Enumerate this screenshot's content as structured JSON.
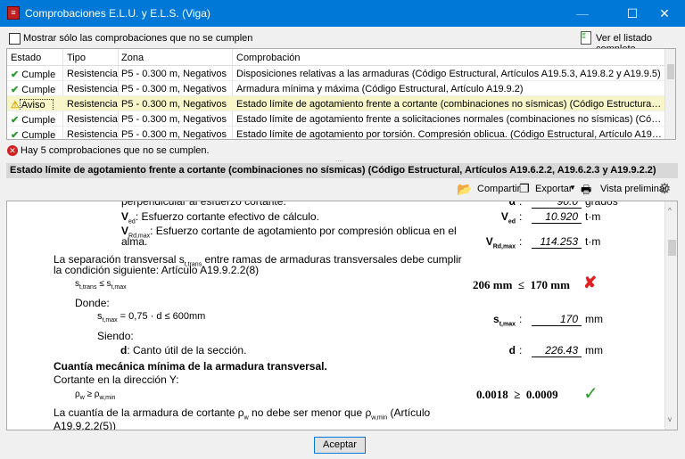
{
  "window": {
    "title": "Comprobaciones E.L.U. y E.L.S. (Viga)",
    "minimize": "—",
    "maximize": "☐",
    "close": "✕"
  },
  "filter": {
    "checkbox_label": "Mostrar sólo las comprobaciones que no se cumplen",
    "checked": false,
    "full_list_label": "Ver el listado completo"
  },
  "table": {
    "headers": [
      "Estado",
      "Tipo",
      "Zona",
      "Comprobación"
    ],
    "rows": [
      {
        "estado": "Cumple",
        "icon": "check",
        "tipo": "Resistencia",
        "zona": "P5 - 0.300 m, Negativos",
        "comprobacion": "Disposiciones relativas a las armaduras (Código Estructural, Artículos A19.5.3, A19.8.2 y A19.9.5)"
      },
      {
        "estado": "Cumple",
        "icon": "check",
        "tipo": "Resistencia",
        "zona": "P5 - 0.300 m, Negativos",
        "comprobacion": "Armadura mínima y máxima (Código Estructural, Artículo A19.9.2)"
      },
      {
        "estado": "Aviso",
        "icon": "warning",
        "tipo": "Resistencia",
        "zona": "P5 - 0.300 m, Negativos",
        "comprobacion": "Estado límite de agotamiento frente a cortante (combinaciones no sísmicas) (Código Estructural, Artículos A19.6.2.2, ..."
      },
      {
        "estado": "Cumple",
        "icon": "check",
        "tipo": "Resistencia",
        "zona": "P5 - 0.300 m, Negativos",
        "comprobacion": "Estado límite de agotamiento frente a solicitaciones normales (combinaciones no sísmicas) (Código Estructural, Artícu..."
      },
      {
        "estado": "Cumple",
        "icon": "check",
        "tipo": "Resistencia",
        "zona": "P5 - 0.300 m, Negativos",
        "comprobacion": "Estado límite de agotamiento por torsión. Compresión oblicua. (Código Estructural, Artículo A19.6.3.2(4))"
      }
    ]
  },
  "status": {
    "message": "Hay 5 comprobaciones que no se cumplen."
  },
  "section": {
    "title": "Estado límite de agotamiento frente a cortante (combinaciones no sísmicas) (Código Estructural, Artículos A19.6.2.2, A19.6.2.3 y A19.9.2.2)"
  },
  "toolbar": {
    "share": "Compartir",
    "export": "Exportar",
    "preview": "Vista preliminar"
  },
  "content": {
    "l0": "perpendicular al esfuerzo cortante.",
    "alpha_sym": "α",
    "alpha_val": "90.0",
    "alpha_unit": "grados",
    "ved_sym": "V",
    "ved_sub": "ed",
    "ved_desc": ": Esfuerzo cortante efectivo de cálculo.",
    "ved_val": "10.920",
    "ved_unit": "t·m",
    "vrd_sym": "V",
    "vrd_sub": "Rd,max",
    "vrd_desc1": ": Esfuerzo cortante de agotamiento por compresión oblicua en el",
    "vrd_desc2": "alma.",
    "vrd_val": "114.253",
    "vrd_unit": "t·m",
    "p1a": "La separación transversal s",
    "p1sub": "t,trans",
    "p1b": " entre ramas de armaduras transversales debe cumplir",
    "p1c": "la condición siguiente: Artículo A19.9.2.2(8)",
    "f1": "s",
    "f1sub": "t,trans",
    "f1mid": " ≤ s",
    "f1sub2": "t,max",
    "f1res": "206 mm  ≤  170 mm",
    "donde": "Donde:",
    "stmax": "s",
    "stmax_sub": "t,max",
    "stmax_expr": " = 0,75 · d ≤ 600mm",
    "stmax_val": "170",
    "stmax_unit": "mm",
    "siendo": "Siendo:",
    "d_sym": "d",
    "d_desc": ": Canto útil de la sección.",
    "d_val": "226.43",
    "d_unit": "mm",
    "h2": "Cuantía mecánica mínima de la armadura transversal.",
    "cort": "Cortante en la dirección Y:",
    "f2": "ρ",
    "f2sub": "w",
    "f2mid": " ≥ ρ",
    "f2sub2": "w,min",
    "f2res": "0.0018  ≥  0.0009",
    "p2a": "La cuantía de la armadura de cortante ρ",
    "p2sub": "w",
    "p2b": " no debe ser menor que ρ",
    "p2sub2": "w,min",
    "p2c": " (Artículo",
    "p2d": "A19.9.2.2(5))"
  },
  "footer": {
    "accept": "Aceptar"
  },
  "colors": {
    "titlebar": "#0078d7",
    "ok": "#2a9a2a",
    "fail": "#e02020",
    "warning_row": "#f6f6c8"
  }
}
